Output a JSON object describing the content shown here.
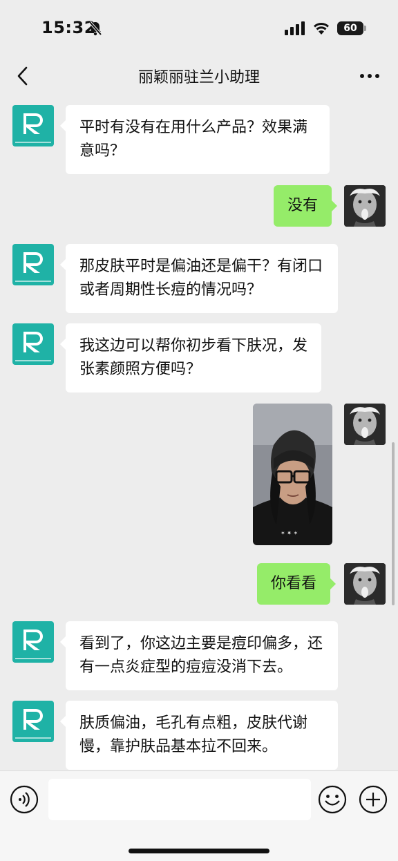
{
  "status_bar": {
    "time": "15:32",
    "battery": "60"
  },
  "nav": {
    "title": "丽颖丽驻兰小助理"
  },
  "messages": [
    {
      "side": "left",
      "text": "平时有没有在用什么产品？效果满意吗？"
    },
    {
      "side": "right",
      "text": "没有"
    },
    {
      "side": "left",
      "text": "那皮肤平时是偏油还是偏干？有闭口或者周期性长痘的情况吗？"
    },
    {
      "side": "left",
      "text": "我这边可以帮你初步看下肤况，发张素颜照方便吗？"
    },
    {
      "side": "right",
      "type": "image"
    },
    {
      "side": "right",
      "text": "你看看"
    },
    {
      "side": "left",
      "text": "看到了，你这边主要是痘印偏多，还有一点炎症型的痘痘没消下去。"
    },
    {
      "side": "left",
      "text": "肤质偏油，毛孔有点粗，皮肤代谢慢，靠护肤品基本拉不回来。"
    }
  ],
  "colors": {
    "bot_avatar": "#1fb2a6",
    "my_bubble": "#95ec69",
    "background": "#ededed"
  },
  "icons": {
    "back": "chevron-left-icon",
    "more": "more-dots-icon",
    "voice": "voice-icon",
    "emoji": "emoji-icon",
    "plus": "plus-icon",
    "bell": "bell-slash-icon"
  }
}
